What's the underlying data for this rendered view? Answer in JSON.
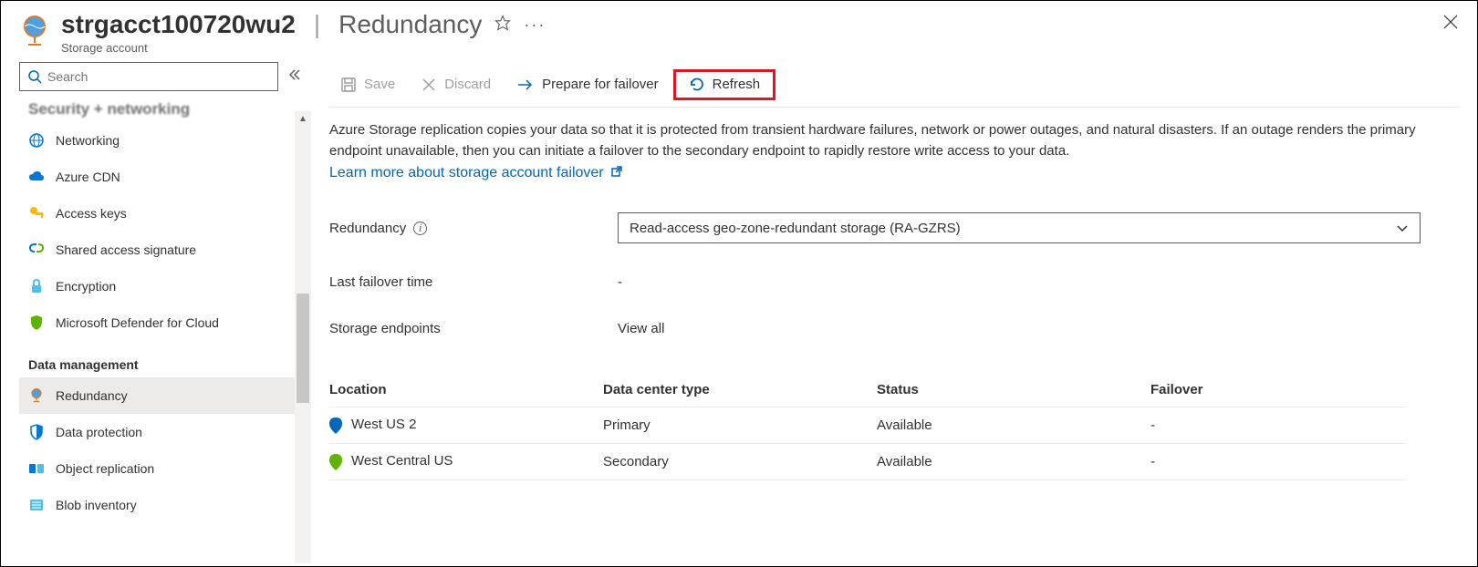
{
  "header": {
    "resource_name": "strgacct100720wu2",
    "page_name": "Redundancy",
    "subtitle": "Storage account"
  },
  "search": {
    "placeholder": "Search"
  },
  "sidebar": {
    "truncated_section": "Security + networking",
    "items": [
      {
        "label": "Networking",
        "icon": "network-icon"
      },
      {
        "label": "Azure CDN",
        "icon": "cloud-icon"
      },
      {
        "label": "Access keys",
        "icon": "key-icon"
      },
      {
        "label": "Shared access signature",
        "icon": "link-icon"
      },
      {
        "label": "Encryption",
        "icon": "lock-icon"
      },
      {
        "label": "Microsoft Defender for Cloud",
        "icon": "shield-icon"
      }
    ],
    "section2": "Data management",
    "items2": [
      {
        "label": "Redundancy",
        "icon": "globe-icon",
        "active": true
      },
      {
        "label": "Data protection",
        "icon": "protection-icon"
      },
      {
        "label": "Object replication",
        "icon": "replication-icon"
      },
      {
        "label": "Blob inventory",
        "icon": "inventory-icon"
      }
    ]
  },
  "toolbar": {
    "save": "Save",
    "discard": "Discard",
    "prepare": "Prepare for failover",
    "refresh": "Refresh"
  },
  "content": {
    "description": "Azure Storage replication copies your data so that it is protected from transient hardware failures, network or power outages, and natural disasters. If an outage renders the primary endpoint unavailable, then you can initiate a failover to the secondary endpoint to rapidly restore write access to your data.",
    "learn_more": "Learn more about storage account failover",
    "redundancy_label": "Redundancy",
    "redundancy_value": "Read-access geo-zone-redundant storage (RA-GZRS)",
    "last_failover_label": "Last failover time",
    "last_failover_value": "-",
    "endpoints_label": "Storage endpoints",
    "endpoints_link": "View all"
  },
  "table": {
    "headers": {
      "location": "Location",
      "dctype": "Data center type",
      "status": "Status",
      "failover": "Failover"
    },
    "rows": [
      {
        "location": "West US 2",
        "dctype": "Primary",
        "status": "Available",
        "failover": "-",
        "pin": "#0067b8"
      },
      {
        "location": "West Central US",
        "dctype": "Secondary",
        "status": "Available",
        "failover": "-",
        "pin": "#5db300"
      }
    ]
  }
}
